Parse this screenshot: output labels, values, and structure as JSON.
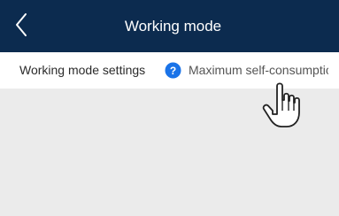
{
  "header": {
    "title": "Working mode",
    "back_icon": "chevron-left-icon",
    "background": "#0c2b4f"
  },
  "settings_row": {
    "label": "Working mode settings",
    "help_icon": "question-circle-icon",
    "help_icon_color": "#1a73e8",
    "value": "Maximum self-consumptic"
  },
  "cursor_icon": "hand-pointer-icon"
}
